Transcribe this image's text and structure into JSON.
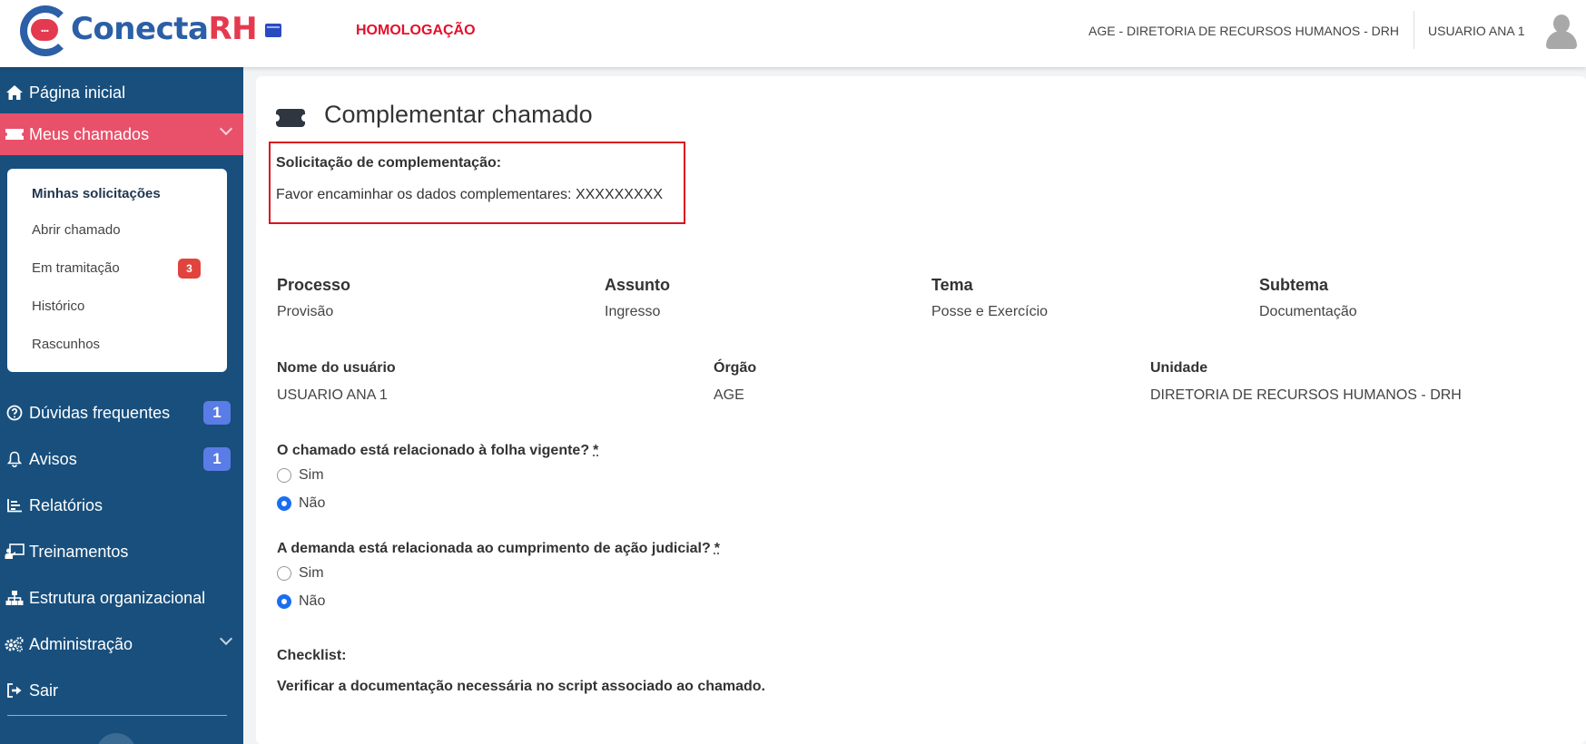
{
  "header": {
    "logo_text": "Conecta",
    "logo_rh": "RH",
    "logo_bubble": "...",
    "env_label": "HOMOLOGAÇÃO",
    "org_name": "AGE - DIRETORIA DE RECURSOS HUMANOS - DRH",
    "user_name": "USUARIO ANA 1"
  },
  "sidebar": {
    "items": [
      {
        "label": "Página inicial",
        "icon": "home-icon"
      },
      {
        "label": "Meus chamados",
        "icon": "ticket-icon",
        "active": true
      },
      {
        "label": "Dúvidas frequentes",
        "icon": "question-icon",
        "badge": "1"
      },
      {
        "label": "Avisos",
        "icon": "bell-icon",
        "badge": "1"
      },
      {
        "label": "Relatórios",
        "icon": "chart-icon"
      },
      {
        "label": "Treinamentos",
        "icon": "training-icon"
      },
      {
        "label": "Estrutura organizacional",
        "icon": "sitemap-icon"
      },
      {
        "label": "Administração",
        "icon": "cogs-icon"
      },
      {
        "label": "Sair",
        "icon": "logout-icon"
      }
    ],
    "submenu": [
      {
        "label": "Minhas solicitações",
        "selected": true
      },
      {
        "label": "Abrir chamado"
      },
      {
        "label": "Em tramitação",
        "badge": "3"
      },
      {
        "label": "Histórico"
      },
      {
        "label": "Rascunhos"
      }
    ]
  },
  "main": {
    "title": "Complementar chamado",
    "request_label": "Solicitação de complementação:",
    "request_text": "Favor encaminhar os dados complementares: XXXXXXXXX",
    "fields_row1": [
      {
        "label": "Processo",
        "value": "Provisão"
      },
      {
        "label": "Assunto",
        "value": "Ingresso"
      },
      {
        "label": "Tema",
        "value": "Posse e Exercício"
      },
      {
        "label": "Subtema",
        "value": "Documentação"
      }
    ],
    "fields_row2": [
      {
        "label": "Nome do usuário",
        "value": "USUARIO ANA 1"
      },
      {
        "label": "Órgão",
        "value": "AGE"
      },
      {
        "label": "Unidade",
        "value": "DIRETORIA DE RECURSOS HUMANOS - DRH"
      }
    ],
    "question1": {
      "label": "O chamado está relacionado à folha vigente?",
      "required": "*",
      "options": [
        "Sim",
        "Não"
      ],
      "selected": "Não"
    },
    "question2": {
      "label": "A demanda está relacionada ao cumprimento de ação judicial?",
      "required": "*",
      "options": [
        "Sim",
        "Não"
      ],
      "selected": "Não"
    },
    "checklist_label": "Checklist:",
    "checklist_text": "Verificar a documentação necessária no script associado ao chamado."
  },
  "colors": {
    "sidebar_bg": "#184f7d",
    "active_item": "#e9516a",
    "env_label": "#e4102b",
    "highlight_border": "#d9121f",
    "radio_selected": "#1a6ff0"
  }
}
